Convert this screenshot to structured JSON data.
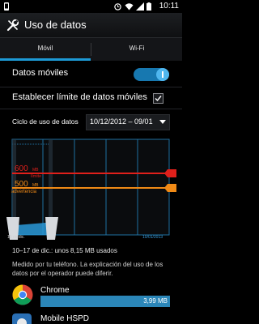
{
  "status": {
    "time": "10:11"
  },
  "header": {
    "title": "Uso de datos"
  },
  "tabs": [
    {
      "label": "Móvil",
      "selected": true
    },
    {
      "label": "Wi-Fi",
      "selected": false
    }
  ],
  "settings": {
    "mobile_data": {
      "label": "Datos móviles",
      "enabled": true
    },
    "limit": {
      "label": "Establecer límite de datos móviles",
      "checked": true
    },
    "cycle": {
      "label": "Ciclo de uso de datos",
      "value": "10/12/2012 – 09/01"
    }
  },
  "graph": {
    "limit_value": "600",
    "limit_unit": "MB",
    "limit_label": "límite",
    "warning_value": "500",
    "warning_unit": "MB",
    "warning_label": "advertencia",
    "start_label": "10 de dic.",
    "end_label": "10/01/2013",
    "colors": {
      "limit": "#e0201b",
      "warning": "#f08a16",
      "grid": "#1f6fa0",
      "usage": "#2a9ad8"
    }
  },
  "usage": {
    "summary": "10–17 de dic.: unos 8,15 MB usados",
    "note": "Medido por tu teléfono. La explicación del uso de los datos por el operador puede diferir."
  },
  "apps": [
    {
      "name": "Chrome",
      "size": "3,99 MB",
      "icon": "chrome-icon",
      "fraction": 1.0
    },
    {
      "name": "Mobile HSPD",
      "size": "",
      "icon": "sony-app-icon",
      "fraction": 0.0
    }
  ]
}
